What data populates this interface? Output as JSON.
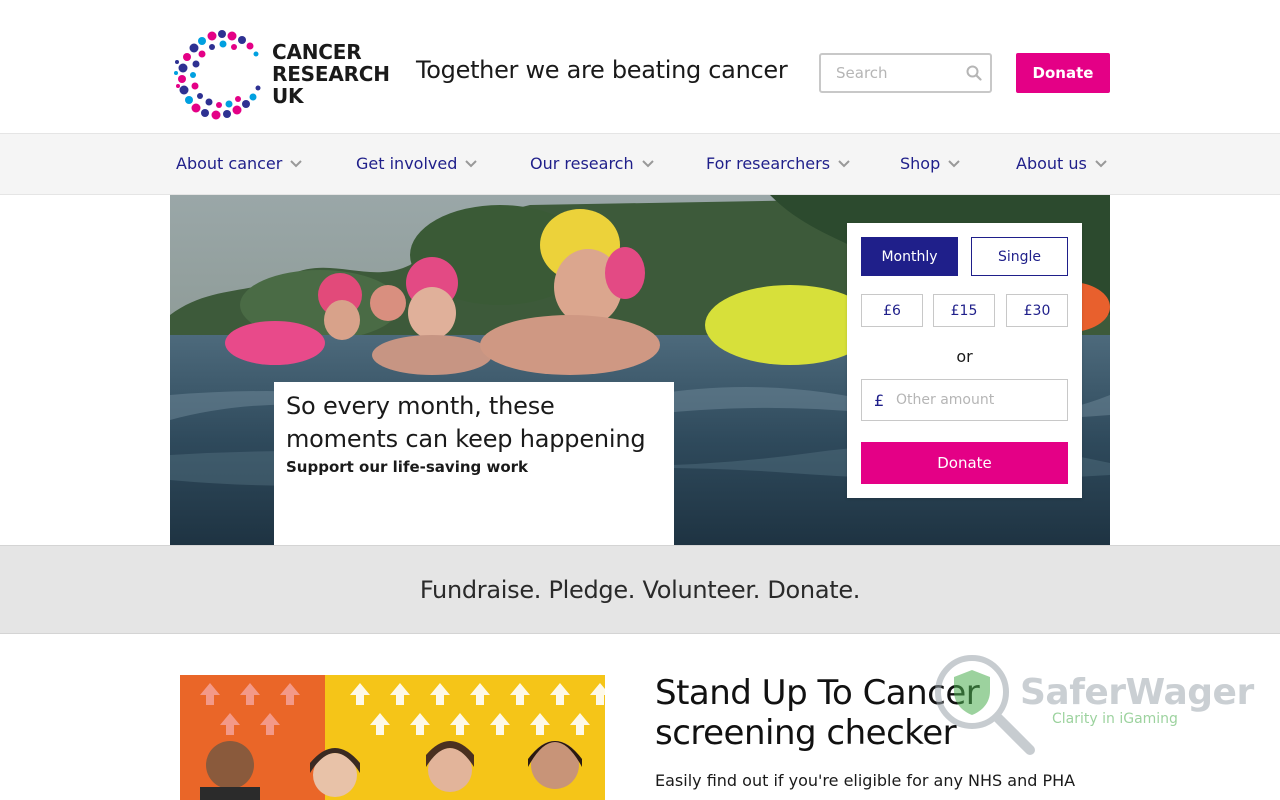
{
  "brand": {
    "name_lines": [
      "CANCER",
      "RESEARCH",
      "UK"
    ],
    "tagline": "Together we are beating cancer",
    "colors": {
      "pink": "#e40086",
      "navy": "#1f1f8a",
      "blue": "#2e3192",
      "light_blue": "#00a0e0"
    }
  },
  "header": {
    "search_placeholder": "Search",
    "search_icon": "search-icon",
    "donate_label": "Donate"
  },
  "nav": {
    "items": [
      {
        "label": "About cancer"
      },
      {
        "label": "Get involved"
      },
      {
        "label": "Our research"
      },
      {
        "label": "For researchers"
      },
      {
        "label": "Shop"
      },
      {
        "label": "About us"
      }
    ]
  },
  "hero": {
    "headline": "So every month, these moments can keep happening",
    "subline": "Support our life-saving work"
  },
  "donate_panel": {
    "frequency": {
      "monthly": "Monthly",
      "single": "Single",
      "selected": "Monthly"
    },
    "amounts": [
      "£6",
      "£15",
      "£30"
    ],
    "or_label": "or",
    "currency_symbol": "£",
    "other_placeholder": "Other amount",
    "donate_label": "Donate"
  },
  "strapline": "Fundraise. Pledge. Volunteer. Donate.",
  "feature": {
    "title": "Stand Up To Cancer screening checker",
    "text": "Easily find out if you're eligible for any NHS and PHA"
  },
  "watermark": {
    "title": "SaferWager",
    "subtitle": "Clarity in iGaming"
  }
}
